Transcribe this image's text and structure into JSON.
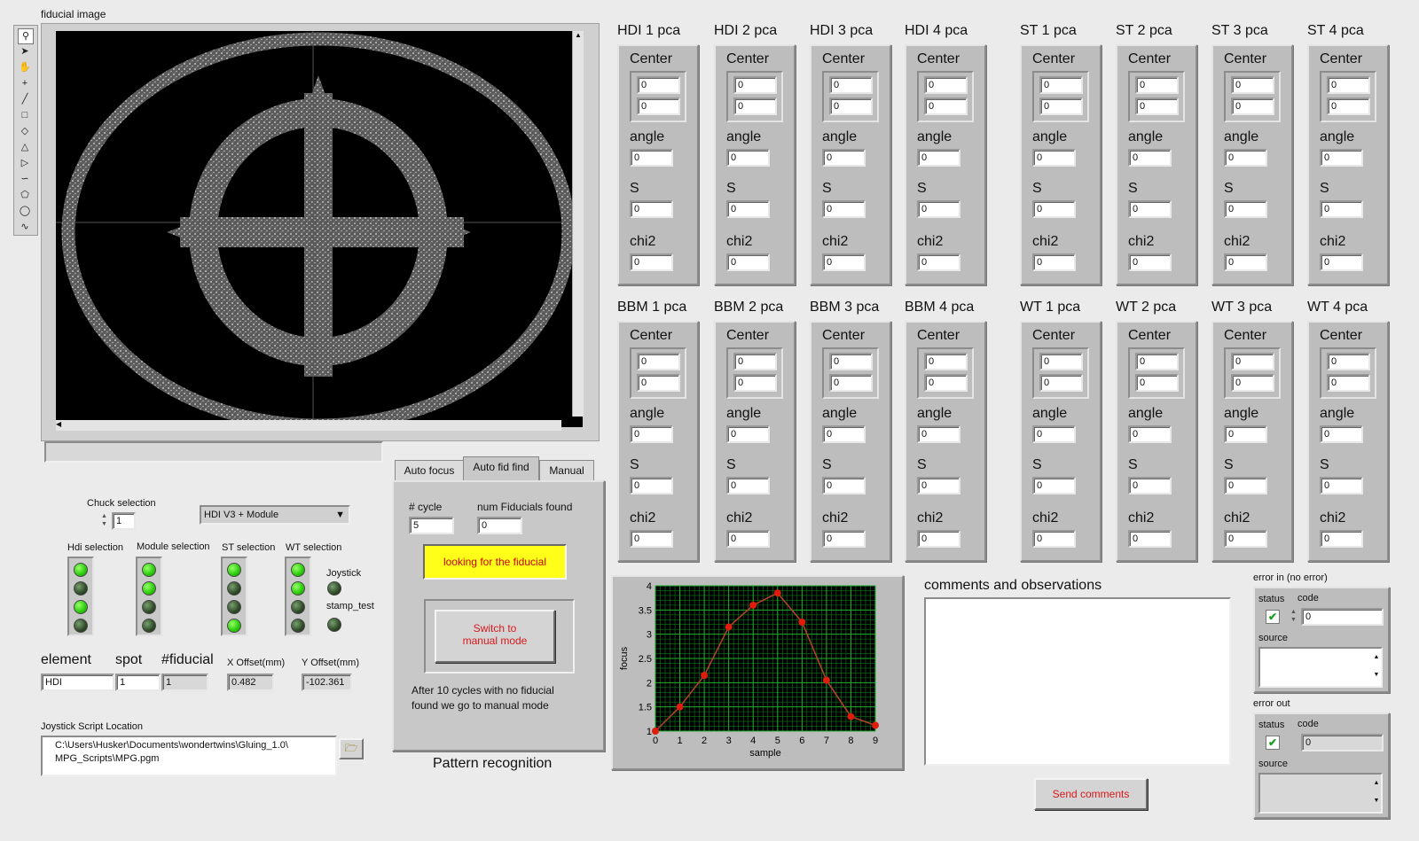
{
  "fiducial_title": "fiducial image",
  "toolbar": {
    "icons": [
      "zoom-icon",
      "pointer-icon",
      "hand-icon",
      "crosshair-icon",
      "line-icon",
      "rectangle-icon",
      "rotated-rect-icon",
      "annulus-icon",
      "polygon-icon",
      "freehand-icon",
      "free-polygon-icon",
      "oval-icon",
      "broken-line-icon"
    ]
  },
  "chuck": {
    "label": "Chuck selection",
    "value": "1",
    "dropdown_value": "HDI V3 + Module"
  },
  "selections": {
    "hdi": "Hdi selection",
    "module": "Module selection",
    "st": "ST selection",
    "wt": "WT selection",
    "joystick": "Joystick",
    "stamp_test": "stamp_test",
    "hdi_leds": [
      true,
      false,
      true,
      false
    ],
    "module_leds": [
      true,
      true,
      false,
      false
    ],
    "st_leds": [
      true,
      false,
      false,
      true
    ],
    "wt_leds": [
      true,
      true,
      false,
      false
    ],
    "joystick_led": false,
    "stamp_led": false
  },
  "element_row": {
    "element_label": "element",
    "spot_label": "spot",
    "fiducial_label": "#fiducial",
    "x_label": "X Offset(mm)",
    "y_label": "Y Offset(mm)",
    "element_value": "HDI",
    "spot_value": "1",
    "fiducial_value": "1",
    "x_value": "0.482",
    "y_value": "-102.361"
  },
  "joystick_script": {
    "label": "Joystick Script Location",
    "path_line1": "C:\\Users\\Husker\\Documents\\wondertwins\\Gluing_1.0\\",
    "path_line2": "MPG_Scripts\\MPG.pgm"
  },
  "tabs": {
    "auto_focus": "Auto focus",
    "auto_fid_find": "Auto fid find",
    "manual": "Manual"
  },
  "autofid": {
    "cycle_label": "# cycle",
    "cycle_value": "5",
    "num_found_label": "num Fiducials found",
    "num_found_value": "0",
    "status": "looking for the fiducial",
    "switch_line1": "Switch to",
    "switch_line2": "manual mode",
    "note_line1": "After 10 cycles with no fiducial",
    "note_line2": "found we go to manual mode",
    "caption": "Pattern recognition"
  },
  "pca_top": [
    {
      "title": "HDI 1 pca"
    },
    {
      "title": "HDI 2 pca"
    },
    {
      "title": "HDI 3 pca"
    },
    {
      "title": "HDI 4 pca"
    },
    {
      "title": "ST 1 pca"
    },
    {
      "title": "ST 2 pca"
    },
    {
      "title": "ST 3 pca"
    },
    {
      "title": "ST 4 pca"
    }
  ],
  "pca_bottom": [
    {
      "title": "BBM 1 pca"
    },
    {
      "title": "BBM 2 pca"
    },
    {
      "title": "BBM 3 pca"
    },
    {
      "title": "BBM 4 pca"
    },
    {
      "title": "WT 1 pca"
    },
    {
      "title": "WT 2 pca"
    },
    {
      "title": "WT 3 pca"
    },
    {
      "title": "WT 4 pca"
    }
  ],
  "pca_labels": {
    "center": "Center",
    "angle": "angle",
    "s": "S",
    "chi2": "chi2",
    "zero": "0"
  },
  "chart_data": {
    "type": "line",
    "x": [
      0,
      1,
      2,
      3,
      4,
      5,
      6,
      7,
      8,
      9
    ],
    "y": [
      1.0,
      1.5,
      2.15,
      3.15,
      3.6,
      3.85,
      3.25,
      2.05,
      1.3,
      1.12
    ],
    "xlabel": "sample",
    "ylabel": "focus",
    "xlim": [
      0,
      9
    ],
    "ylim": [
      1,
      4
    ],
    "xticks": [
      "0",
      "1",
      "2",
      "3",
      "4",
      "5",
      "6",
      "7",
      "8",
      "9"
    ],
    "yticks": [
      "1",
      "1.5",
      "2",
      "2.5",
      "3",
      "3.5",
      "4"
    ],
    "grid": true,
    "colors": {
      "background": "#000000",
      "grid": "#0d7a1e",
      "line": "#b7442a",
      "marker": "#e01d0d"
    }
  },
  "comments": {
    "label": "comments and observations",
    "value": "",
    "send_label": "Send comments"
  },
  "error_in": {
    "title": "error in (no error)",
    "status_label": "status",
    "code_label": "code",
    "code_value": "0",
    "source_label": "source"
  },
  "error_out": {
    "title": "error out",
    "status_label": "status",
    "code_label": "code",
    "code_value": "0",
    "source_label": "source"
  }
}
